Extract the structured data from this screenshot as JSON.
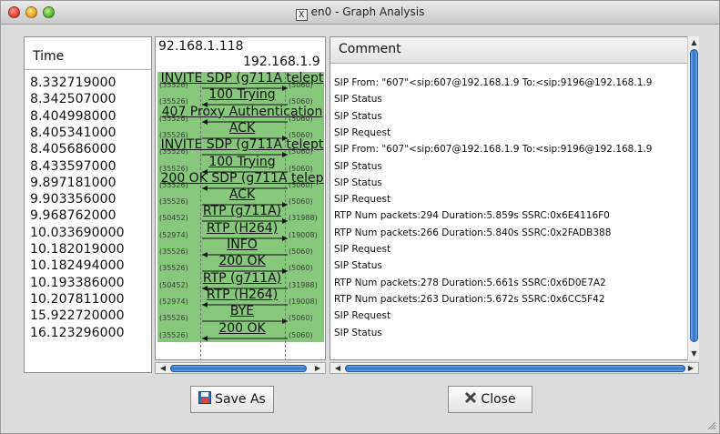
{
  "window": {
    "title": "en0 - Graph Analysis",
    "title_icon": "X"
  },
  "time_column": {
    "header": "Time",
    "rows": [
      "8.332719000",
      "8.342507000",
      "8.404998000",
      "8.405341000",
      "8.405686000",
      "8.433597000",
      "9.897181000",
      "9.903356000",
      "9.968762000",
      "10.033690000",
      "10.182019000",
      "10.182494000",
      "10.193386000",
      "10.207811000",
      "15.922720000",
      "16.123296000"
    ]
  },
  "graph": {
    "node_a": "92.168.1.118",
    "node_b": "192.168.1.9",
    "fill_color": "#86c97b",
    "messages": [
      {
        "label": "INVITE SDP (g711A telept",
        "dir": "right",
        "left_port": "(35526)",
        "right_port": "(5060)"
      },
      {
        "label": "100 Trying",
        "dir": "left",
        "left_port": "(35526)",
        "right_port": "(5060)"
      },
      {
        "label": "407 Proxy Authentication",
        "dir": "left",
        "left_port": "(35526)",
        "right_port": "(5060)"
      },
      {
        "label": "ACK",
        "dir": "right",
        "left_port": "(35526)",
        "right_port": "(5060)"
      },
      {
        "label": "INVITE SDP (g711A telept",
        "dir": "right",
        "left_port": "(35526)",
        "right_port": "(5060)"
      },
      {
        "label": "100 Trying",
        "dir": "left",
        "left_port": "(35526)",
        "right_port": "(5060)"
      },
      {
        "label": "200 OK SDP (g711A telep",
        "dir": "left",
        "left_port": "(35526)",
        "right_port": "(5060)"
      },
      {
        "label": "ACK",
        "dir": "right",
        "left_port": "(35526)",
        "right_port": "(5060)"
      },
      {
        "label": "RTP (g711A)",
        "dir": "right",
        "left_port": "(50452)",
        "right_port": "(31988)"
      },
      {
        "label": "RTP (H264)",
        "dir": "right",
        "left_port": "(52974)",
        "right_port": "(19008)"
      },
      {
        "label": "INFO",
        "dir": "left",
        "left_port": "(35526)",
        "right_port": "(5060)"
      },
      {
        "label": "200 OK",
        "dir": "right",
        "left_port": "(35526)",
        "right_port": "(5060)"
      },
      {
        "label": "RTP (g711A)",
        "dir": "left",
        "left_port": "(50452)",
        "right_port": "(31988)"
      },
      {
        "label": "RTP (H264)",
        "dir": "left",
        "left_port": "(52974)",
        "right_port": "(19008)"
      },
      {
        "label": "BYE",
        "dir": "right",
        "left_port": "(35526)",
        "right_port": "(5060)"
      },
      {
        "label": "200 OK",
        "dir": "left",
        "left_port": "(35526)",
        "right_port": "(5060)"
      }
    ]
  },
  "comment_column": {
    "header": "Comment",
    "rows": [
      "SIP From: \"607\"<sip:607@192.168.1.9 To:<sip:9196@192.168.1.9",
      "SIP Status",
      "SIP Status",
      "SIP Request",
      "SIP From: \"607\"<sip:607@192.168.1.9 To:<sip:9196@192.168.1.9",
      "SIP Status",
      "SIP Status",
      "SIP Request",
      "RTP Num packets:294  Duration:5.859s SSRC:0x6E4116F0",
      "RTP Num packets:266  Duration:5.840s SSRC:0x2FADB388",
      "SIP Request",
      "SIP Status",
      "RTP Num packets:278  Duration:5.661s SSRC:0x6D0E7A2",
      "RTP Num packets:263  Duration:5.672s SSRC:0x6CC5F42",
      "SIP Request",
      "SIP Status"
    ]
  },
  "buttons": {
    "save_as": "Save As",
    "close": "Close"
  },
  "icons": {
    "save": "floppy-disk-icon",
    "close": "close-x-icon"
  }
}
